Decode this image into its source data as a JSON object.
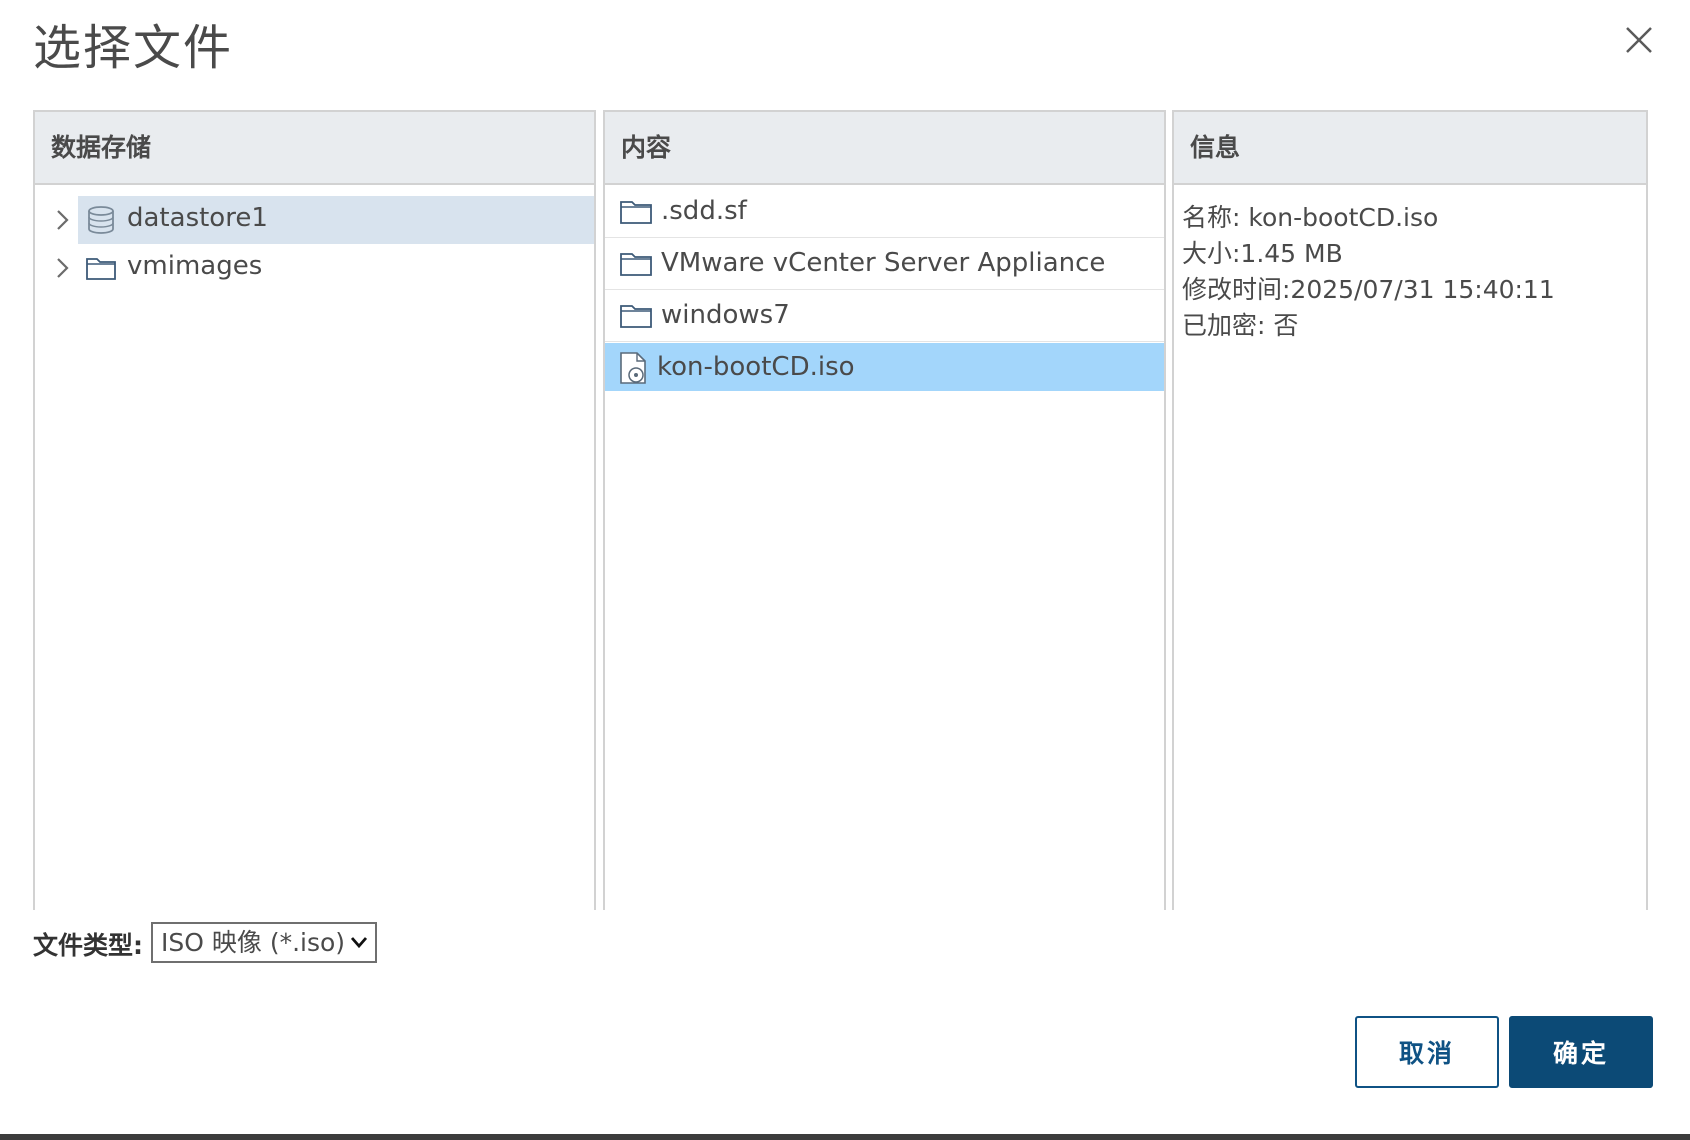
{
  "dialog": {
    "title": "选择文件"
  },
  "datastore_panel": {
    "header": "数据存储",
    "items": [
      {
        "label": "datastore1",
        "icon": "database-icon",
        "selected": true
      },
      {
        "label": "vmimages",
        "icon": "folder-icon",
        "selected": false
      }
    ]
  },
  "contents_panel": {
    "header": "内容",
    "items": [
      {
        "label": ".sdd.sf",
        "icon": "folder-icon"
      },
      {
        "label": "VMware vCenter Server Appliance",
        "icon": "folder-icon"
      },
      {
        "label": "windows7",
        "icon": "folder-icon"
      },
      {
        "label": "kon-bootCD.iso",
        "icon": "iso-file-icon",
        "selected": true
      }
    ]
  },
  "info_panel": {
    "header": "信息",
    "lines": [
      "名称: kon-bootCD.iso",
      "大小:1.45 MB",
      "修改时间:2025/07/31 15:40:11",
      "已加密: 否"
    ]
  },
  "file_type": {
    "label": "文件类型:",
    "selected": "ISO 映像 (*.iso)"
  },
  "buttons": {
    "cancel": "取消",
    "ok": "确定"
  },
  "colors": {
    "primary": "#0c4a76",
    "selected_row": "#a3d6fb",
    "tree_selected": "#d8e3ee",
    "header_bg": "#e9ecef"
  }
}
